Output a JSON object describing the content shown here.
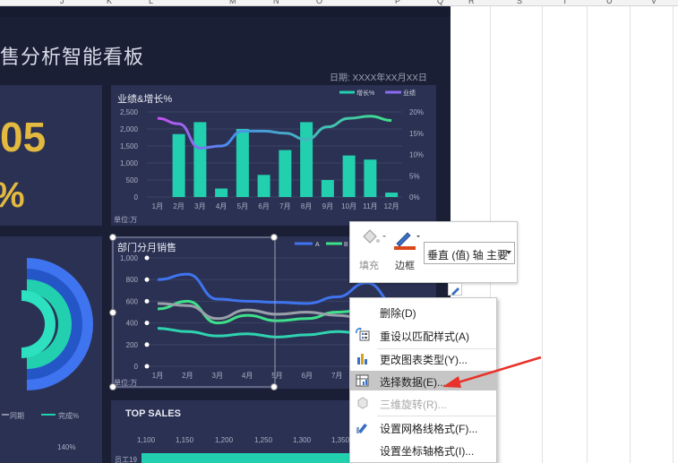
{
  "sheet": {
    "columns": [
      "J",
      "K",
      "L",
      "M",
      "N",
      "O",
      "P",
      "Q",
      "R",
      "S",
      "T",
      "U",
      "V"
    ]
  },
  "dashboard": {
    "title": "售分析智能看板",
    "date_label": "日期:   XXXX年XX月XX日",
    "kpi_value": "05",
    "kpi_percent": "%"
  },
  "chart1": {
    "title": "业绩&增长%",
    "legend": [
      "增长%",
      "业绩"
    ],
    "unit": "单位:万",
    "y_ticks": [
      "2,500",
      "2,000",
      "1,500",
      "1,000",
      "500",
      "0"
    ],
    "y2_ticks": [
      "20%",
      "15%",
      "10%",
      "5%",
      "0%"
    ],
    "x_ticks": [
      "1月",
      "2月",
      "3月",
      "4月",
      "5月",
      "6月",
      "7月",
      "8月",
      "9月",
      "10月",
      "11月",
      "12月"
    ]
  },
  "chart2": {
    "title": "部门分月销售",
    "legend": [
      "A",
      "B"
    ],
    "unit": "单位:万",
    "y_ticks": [
      "1,000",
      "800",
      "600",
      "400",
      "200",
      "0"
    ],
    "x_ticks": [
      "1月",
      "2月",
      "3月",
      "4月",
      "5月",
      "6月",
      "7月",
      "8月",
      "9月",
      "10月"
    ]
  },
  "panel3": {
    "legend": [
      "同期",
      "完成%"
    ],
    "tick": "140%"
  },
  "top_sales": {
    "title": "TOP SALES",
    "x_ticks": [
      "1,100",
      "1,150",
      "1,200",
      "1,250",
      "1,300",
      "1,350"
    ],
    "row_label": "员工19"
  },
  "mini_toolbar": {
    "fill_label": "填充",
    "border_label": "边框",
    "dropdown_value": "垂直 (值) 轴 主要"
  },
  "context_menu": {
    "items": [
      {
        "label": "删除(D)",
        "icon": "none",
        "disabled": false
      },
      {
        "label": "重设以匹配样式(A)",
        "icon": "reset-style-icon",
        "disabled": false
      },
      {
        "label": "更改图表类型(Y)...",
        "icon": "chart-type-icon",
        "disabled": false
      },
      {
        "label": "选择数据(E)...",
        "icon": "select-data-icon",
        "disabled": false,
        "highlighted": true
      },
      {
        "label": "三维旋转(R)...",
        "icon": "rotate-3d-icon",
        "disabled": true
      },
      {
        "label": "设置网格线格式(F)...",
        "icon": "gridline-format-icon",
        "disabled": false
      },
      {
        "label": "设置坐标轴格式(I)...",
        "icon": "none",
        "disabled": false
      }
    ]
  },
  "colors": {
    "dashboard_bg": "#1a1f35",
    "panel_bg": "#2b3152",
    "teal": "#22cfae",
    "blue": "#3f74f0",
    "green": "#3ee08a",
    "gold": "#e3b93f",
    "arrow": "#e8322a"
  },
  "chart_data": [
    {
      "type": "bar",
      "title": "业绩&增长%",
      "categories": [
        "1月",
        "2月",
        "3月",
        "4月",
        "5月",
        "6月",
        "7月",
        "8月",
        "9月",
        "10月",
        "11月",
        "12月"
      ],
      "series": [
        {
          "name": "业绩",
          "values": [
            0,
            1850,
            2200,
            250,
            2000,
            650,
            1380,
            2200,
            500,
            1220,
            1100,
            130
          ]
        },
        {
          "name": "增长%",
          "values": [
            0.185,
            0.172,
            0.115,
            0.12,
            0.155,
            0.155,
            0.15,
            0.135,
            0.165,
            0.185,
            0.19,
            0.18
          ]
        }
      ],
      "ylim": [
        0,
        2500
      ],
      "y2lim": [
        0,
        0.2
      ]
    },
    {
      "type": "line",
      "title": "部门分月销售",
      "categories": [
        "1月",
        "2月",
        "3月",
        "4月",
        "5月",
        "6月",
        "7月",
        "8月",
        "9月",
        "10月"
      ],
      "series": [
        {
          "name": "A",
          "values": [
            800,
            850,
            620,
            600,
            590,
            580,
            640,
            770,
            560,
            580
          ]
        },
        {
          "name": "B",
          "values": [
            530,
            600,
            400,
            470,
            420,
            440,
            500,
            520,
            480,
            460
          ]
        },
        {
          "values": [
            580,
            560,
            440,
            520,
            480,
            500,
            470,
            440,
            460,
            430
          ]
        },
        {
          "values": [
            350,
            320,
            280,
            300,
            270,
            290,
            320,
            300,
            330,
            310
          ]
        }
      ],
      "ylim": [
        0,
        1000
      ]
    }
  ]
}
